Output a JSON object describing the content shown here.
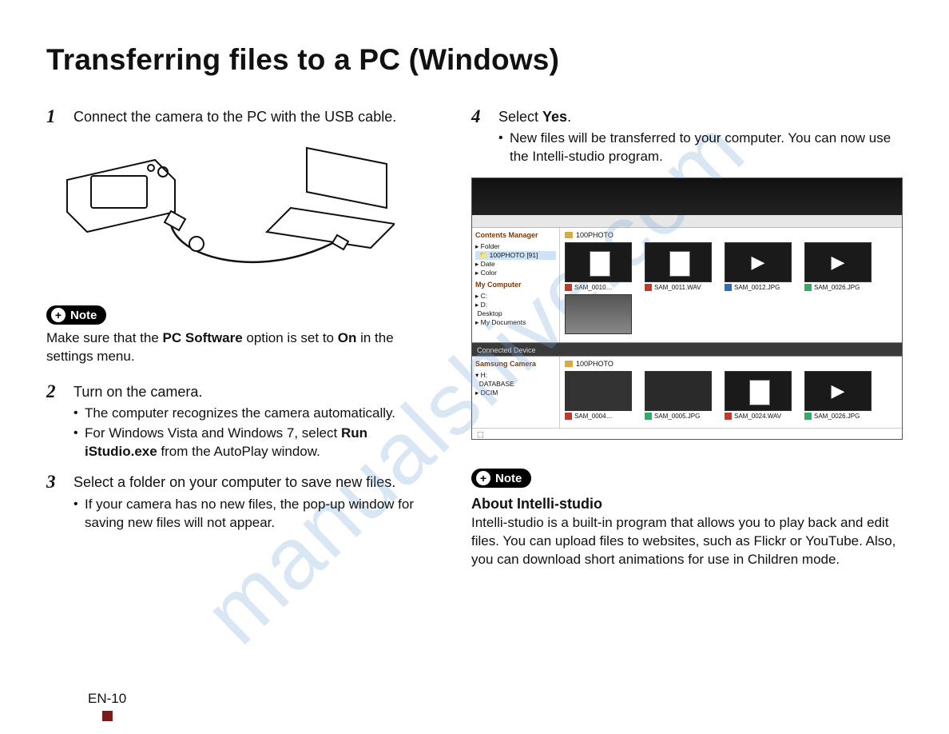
{
  "title": "Transferring files to a PC (Windows)",
  "watermark": "manualshive.com",
  "pageNumber": "EN-10",
  "left": {
    "step1": {
      "num": "1",
      "text": "Connect the camera to the PC with the USB cable."
    },
    "note1": {
      "label": "Note",
      "text_a": "Make sure that the ",
      "bold_a": "PC Software",
      "text_b": " option is set to ",
      "bold_b": "On",
      "text_c": " in the settings menu."
    },
    "step2": {
      "num": "2",
      "text": "Turn on the camera.",
      "b1": "The computer recognizes the camera automatically.",
      "b2_a": "For Windows Vista and Windows 7, select ",
      "b2_bold": "Run iStudio.exe",
      "b2_b": " from the AutoPlay window."
    },
    "step3": {
      "num": "3",
      "text": "Select a folder on your computer to save new files.",
      "b1": "If your camera has no new files, the pop-up window for saving new files will not appear."
    }
  },
  "right": {
    "step4": {
      "num": "4",
      "text_a": "Select ",
      "bold": "Yes",
      "text_b": ".",
      "b1": "New files will be transferred to your computer. You can now use the Intelli-studio program."
    },
    "app": {
      "sidebar": {
        "title1": "Contents Manager",
        "folder": "Folder",
        "folder_item": "100PHOTO",
        "folder_count": "[91]",
        "date": "Date",
        "color": "Color",
        "mycomp": "My Computer",
        "c": "C:",
        "d": "D:",
        "desktop": "Desktop",
        "mydocs": "My Documents",
        "camera": "Samsung Camera",
        "h": "H:",
        "db": "DATABASE",
        "dcim": "DCIM"
      },
      "path1": "100PHOTO",
      "row1": {
        "t1": "SAM_0010…",
        "t2": "SAM_0011.WAV",
        "t3": "SAM_0012.JPG",
        "t4": "SAM_0026.JPG"
      },
      "divider": "Connected Device",
      "path2": "100PHOTO",
      "row2": {
        "t1": "SAM_0004…",
        "t2": "SAM_0005.JPG",
        "t3": "SAM_0024.WAV",
        "t4": "SAM_0026.JPG"
      }
    },
    "note2": {
      "label": "Note",
      "heading": "About Intelli-studio",
      "text": "Intelli-studio is a built-in program that allows you to play back and edit files. You can upload files to websites, such as Flickr or YouTube. Also, you can download short animations for use in Children mode."
    }
  }
}
